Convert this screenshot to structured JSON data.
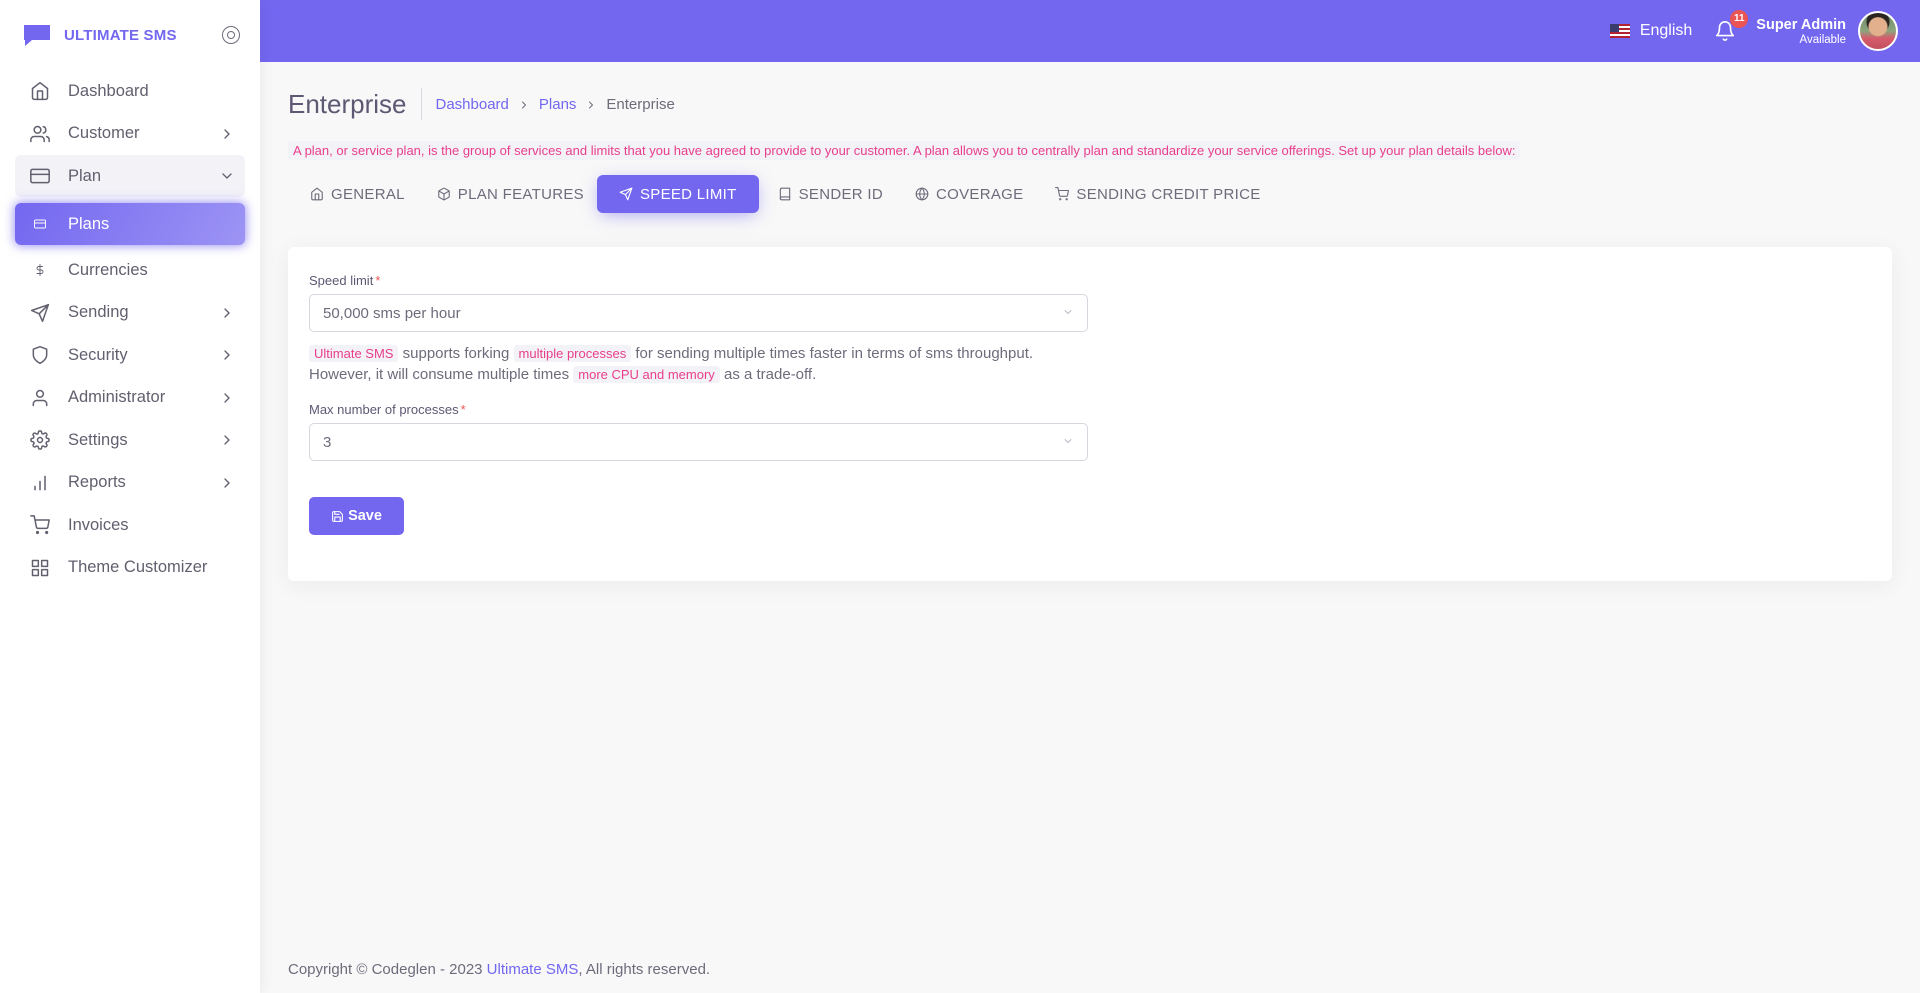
{
  "brand": {
    "name": "ULTIMATE SMS",
    "icon": "chat-logo-icon"
  },
  "sidebar": {
    "items": [
      {
        "label": "Dashboard",
        "icon": "home-icon",
        "has_children": false
      },
      {
        "label": "Customer",
        "icon": "users-icon",
        "has_children": true
      },
      {
        "label": "Plan",
        "icon": "credit-card-icon",
        "has_children": true,
        "open": true
      },
      {
        "label": "Plans",
        "icon": "credit-card-icon",
        "active": true
      },
      {
        "label": "Currencies",
        "icon": "dollar-icon"
      },
      {
        "label": "Sending",
        "icon": "send-icon",
        "has_children": true
      },
      {
        "label": "Security",
        "icon": "shield-icon",
        "has_children": true
      },
      {
        "label": "Administrator",
        "icon": "user-icon",
        "has_children": true
      },
      {
        "label": "Settings",
        "icon": "settings-icon",
        "has_children": true
      },
      {
        "label": "Reports",
        "icon": "bar-chart-icon",
        "has_children": true
      },
      {
        "label": "Invoices",
        "icon": "shopping-cart-icon",
        "has_children": false
      },
      {
        "label": "Theme Customizer",
        "icon": "grid-icon",
        "has_children": false
      }
    ]
  },
  "topbar": {
    "language": "English",
    "notification_count": "11",
    "user_name": "Super Admin",
    "user_status": "Available",
    "accent_color": "#7367f0"
  },
  "page": {
    "title": "Enterprise",
    "breadcrumb": [
      "Dashboard",
      "Plans",
      "Enterprise"
    ],
    "note": "A plan, or service plan, is the group of services and limits that you have agreed to provide to your customer. A plan allows you to centrally plan and standardize your service offerings. Set up your plan details below:"
  },
  "tabs": [
    {
      "label": "GENERAL",
      "icon": "home-icon"
    },
    {
      "label": "PLAN FEATURES",
      "icon": "package-icon"
    },
    {
      "label": "SPEED LIMIT",
      "icon": "send-icon",
      "active": true
    },
    {
      "label": "SENDER ID",
      "icon": "book-icon"
    },
    {
      "label": "COVERAGE",
      "icon": "globe-icon"
    },
    {
      "label": "SENDING CREDIT PRICE",
      "icon": "shopping-cart-icon"
    }
  ],
  "form": {
    "speed_limit_label": "Speed limit",
    "required_mark": "*",
    "speed_limit_value": "50,000 sms per hour",
    "help": {
      "part1": "Ultimate SMS",
      "part2": " supports forking ",
      "part3": "multiple processes",
      "part4": " for sending multiple times faster in terms of sms throughput. However, it will consume multiple times ",
      "part5": "more CPU and memory",
      "part6": " as a trade-off."
    },
    "max_processes_label": "Max number of processes",
    "max_processes_value": "3",
    "save_label": "Save"
  },
  "footer": {
    "text": "Copyright © Codeglen - 2023 ",
    "link": "Ultimate SMS",
    "suffix": ", All rights reserved."
  }
}
